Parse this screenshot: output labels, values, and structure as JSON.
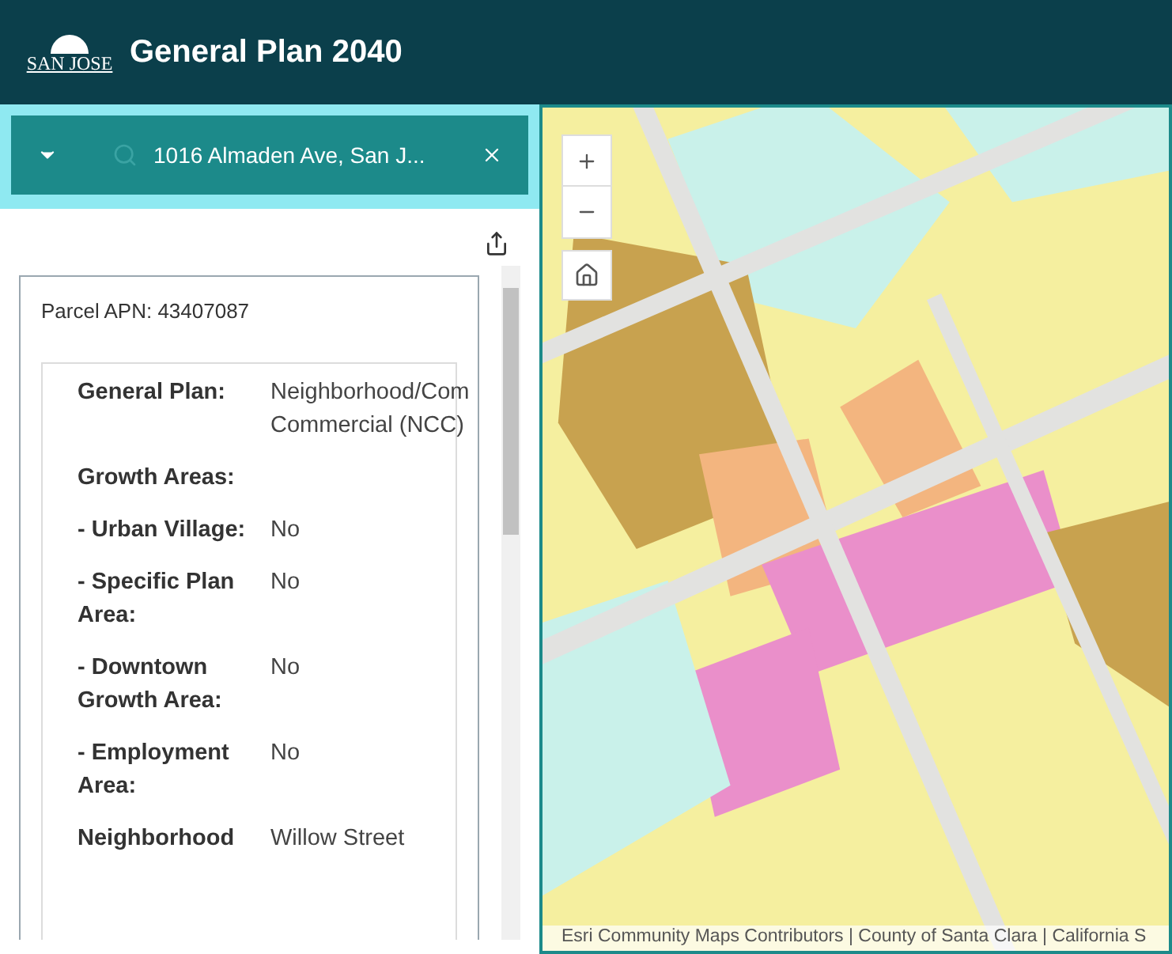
{
  "header": {
    "logo_text": "SAN JOSE",
    "title": "General Plan 2040"
  },
  "search": {
    "value": "1016 Almaden Ave, San J..."
  },
  "card": {
    "title": "Parcel APN: 43407087",
    "rows": [
      {
        "label": "General Plan:",
        "value_lines": [
          "Neighborhood/Com",
          "Commercial (NCC)"
        ]
      },
      {
        "label": "Growth Areas:",
        "value_lines": []
      },
      {
        "label": "- Urban Village:",
        "value_lines": [
          "No"
        ]
      },
      {
        "label": "- Specific Plan Area:",
        "value_lines": [
          "No"
        ]
      },
      {
        "label": "- Downtown Growth Area:",
        "value_lines": [
          "No"
        ]
      },
      {
        "label": "- Employment Area:",
        "value_lines": [
          "No"
        ]
      },
      {
        "label": "Neighborhood",
        "value_lines": [
          "Willow Street"
        ]
      }
    ]
  },
  "map": {
    "kind": "picture",
    "attribution": "Esri Community Maps Contributors | County of Santa Clara | California S"
  }
}
